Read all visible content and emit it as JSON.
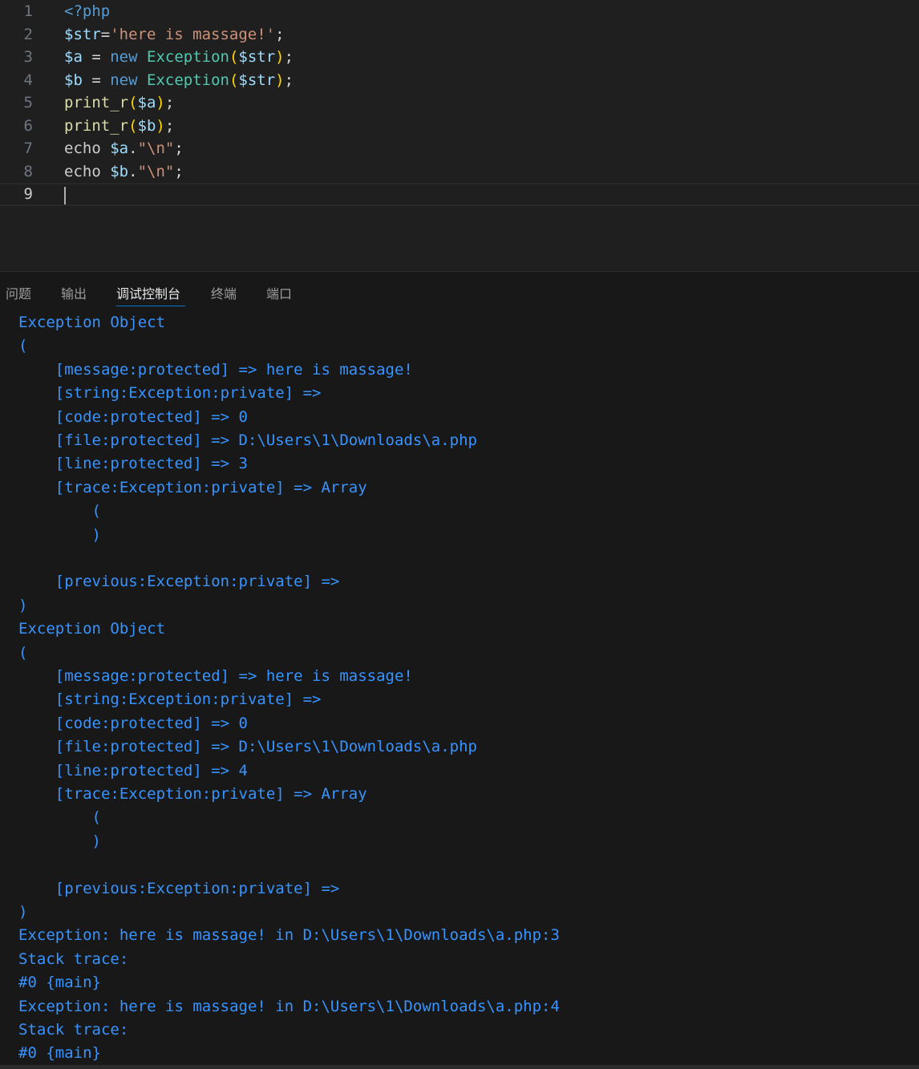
{
  "editor": {
    "lines": [
      {
        "num": "1",
        "tokens": [
          {
            "t": "<?php",
            "c": "kw"
          }
        ]
      },
      {
        "num": "2",
        "tokens": [
          {
            "t": "$str",
            "c": "var"
          },
          {
            "t": "=",
            "c": "op"
          },
          {
            "t": "'here is massage!'",
            "c": "str"
          },
          {
            "t": ";",
            "c": "op"
          }
        ]
      },
      {
        "num": "3",
        "tokens": [
          {
            "t": "$a",
            "c": "var"
          },
          {
            "t": " = ",
            "c": "op"
          },
          {
            "t": "new",
            "c": "kw"
          },
          {
            "t": " ",
            "c": "op"
          },
          {
            "t": "Exception",
            "c": "cls"
          },
          {
            "t": "(",
            "c": "br"
          },
          {
            "t": "$str",
            "c": "var"
          },
          {
            "t": ")",
            "c": "br"
          },
          {
            "t": ";",
            "c": "op"
          }
        ]
      },
      {
        "num": "4",
        "tokens": [
          {
            "t": "$b",
            "c": "var"
          },
          {
            "t": " = ",
            "c": "op"
          },
          {
            "t": "new",
            "c": "kw"
          },
          {
            "t": " ",
            "c": "op"
          },
          {
            "t": "Exception",
            "c": "cls"
          },
          {
            "t": "(",
            "c": "br"
          },
          {
            "t": "$str",
            "c": "var"
          },
          {
            "t": ")",
            "c": "br"
          },
          {
            "t": ";",
            "c": "op"
          }
        ]
      },
      {
        "num": "5",
        "tokens": [
          {
            "t": "print_r",
            "c": "fn"
          },
          {
            "t": "(",
            "c": "br"
          },
          {
            "t": "$a",
            "c": "var"
          },
          {
            "t": ")",
            "c": "br"
          },
          {
            "t": ";",
            "c": "op"
          }
        ]
      },
      {
        "num": "6",
        "tokens": [
          {
            "t": "print_r",
            "c": "fn"
          },
          {
            "t": "(",
            "c": "br"
          },
          {
            "t": "$b",
            "c": "var"
          },
          {
            "t": ")",
            "c": "br"
          },
          {
            "t": ";",
            "c": "op"
          }
        ]
      },
      {
        "num": "7",
        "tokens": [
          {
            "t": "echo",
            "c": "plain"
          },
          {
            "t": " ",
            "c": "op"
          },
          {
            "t": "$a",
            "c": "var"
          },
          {
            "t": ".",
            "c": "op"
          },
          {
            "t": "\"\\n\"",
            "c": "str"
          },
          {
            "t": ";",
            "c": "op"
          }
        ]
      },
      {
        "num": "8",
        "tokens": [
          {
            "t": "echo",
            "c": "plain"
          },
          {
            "t": " ",
            "c": "op"
          },
          {
            "t": "$b",
            "c": "var"
          },
          {
            "t": ".",
            "c": "op"
          },
          {
            "t": "\"\\n\"",
            "c": "str"
          },
          {
            "t": ";",
            "c": "op"
          }
        ]
      },
      {
        "num": "9",
        "tokens": [],
        "current": true
      }
    ]
  },
  "panel": {
    "tabs": [
      {
        "label": "问题",
        "active": false
      },
      {
        "label": "输出",
        "active": false
      },
      {
        "label": "调试控制台",
        "active": true
      },
      {
        "label": "终端",
        "active": false
      },
      {
        "label": "端口",
        "active": false
      }
    ]
  },
  "console": {
    "color": "#3794ff",
    "lines": [
      "Exception Object",
      "(",
      "    [message:protected] => here is massage!",
      "    [string:Exception:private] =>",
      "    [code:protected] => 0",
      "    [file:protected] => D:\\Users\\1\\Downloads\\a.php",
      "    [line:protected] => 3",
      "    [trace:Exception:private] => Array",
      "        (",
      "        )",
      "",
      "    [previous:Exception:private] =>",
      ")",
      "Exception Object",
      "(",
      "    [message:protected] => here is massage!",
      "    [string:Exception:private] =>",
      "    [code:protected] => 0",
      "    [file:protected] => D:\\Users\\1\\Downloads\\a.php",
      "    [line:protected] => 4",
      "    [trace:Exception:private] => Array",
      "        (",
      "        )",
      "",
      "    [previous:Exception:private] =>",
      ")",
      "Exception: here is massage! in D:\\Users\\1\\Downloads\\a.php:3",
      "Stack trace:",
      "#0 {main}",
      "Exception: here is massage! in D:\\Users\\1\\Downloads\\a.php:4",
      "Stack trace:",
      "#0 {main}"
    ]
  }
}
